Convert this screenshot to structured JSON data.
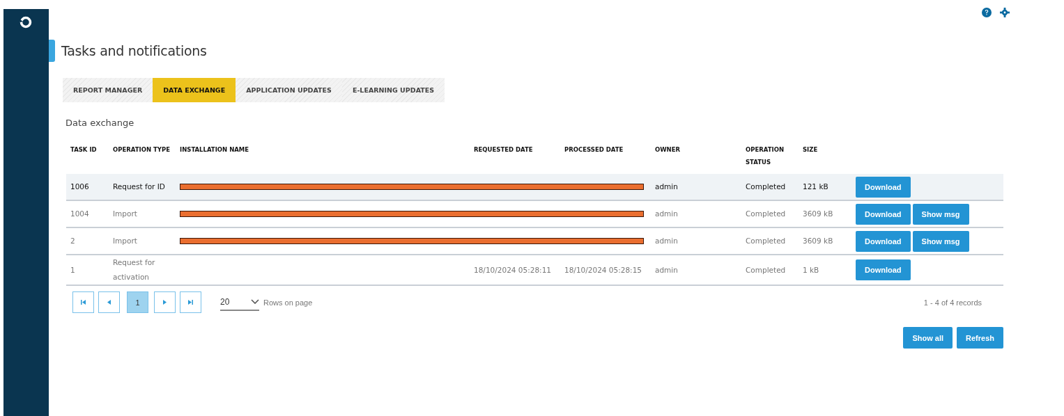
{
  "page": {
    "title": "Tasks and notifications"
  },
  "tabs": [
    {
      "label": "REPORT MANAGER",
      "selected": false
    },
    {
      "label": "DATA EXCHANGE",
      "selected": true
    },
    {
      "label": "APPLICATION UPDATES",
      "selected": false
    },
    {
      "label": "E-LEARNING UPDATES",
      "selected": false
    }
  ],
  "section_title": "Data exchange",
  "table": {
    "columns": [
      "TASK ID",
      "OPERATION TYPE",
      "INSTALLATION NAME",
      "REQUESTED DATE",
      "PROCESSED DATE",
      "OWNER",
      "OPERATION STATUS",
      "SIZE"
    ],
    "rows": [
      {
        "selected": true,
        "task_id": "1006",
        "operation_type": "Request for ID",
        "redacted": true,
        "owner": "admin",
        "status": "Completed",
        "size": "121 kB",
        "actions": [
          "Download"
        ]
      },
      {
        "selected": false,
        "task_id": "1004",
        "operation_type": "Import",
        "redacted": true,
        "owner": "admin",
        "status": "Completed",
        "size": "3609 kB",
        "actions": [
          "Download",
          "Show msg"
        ]
      },
      {
        "selected": false,
        "task_id": "2",
        "operation_type": "Import",
        "redacted": true,
        "owner": "admin",
        "status": "Completed",
        "size": "3609 kB",
        "actions": [
          "Download",
          "Show msg"
        ]
      },
      {
        "selected": false,
        "task_id": "1",
        "operation_type": "Request for activation",
        "redacted": false,
        "requested_date": "18/10/2024 05:28:11",
        "processed_date": "18/10/2024 05:28:15",
        "owner": "admin",
        "status": "Completed",
        "size": "1 kB",
        "actions": [
          "Download"
        ]
      }
    ]
  },
  "pagination": {
    "pages": [
      {
        "label": "1",
        "selected": true
      }
    ],
    "rows_per_page": "20",
    "rows_label": "Rows on page",
    "summary": "1 - 4 of 4 records"
  },
  "buttons": [
    "Show all",
    "Refresh"
  ]
}
